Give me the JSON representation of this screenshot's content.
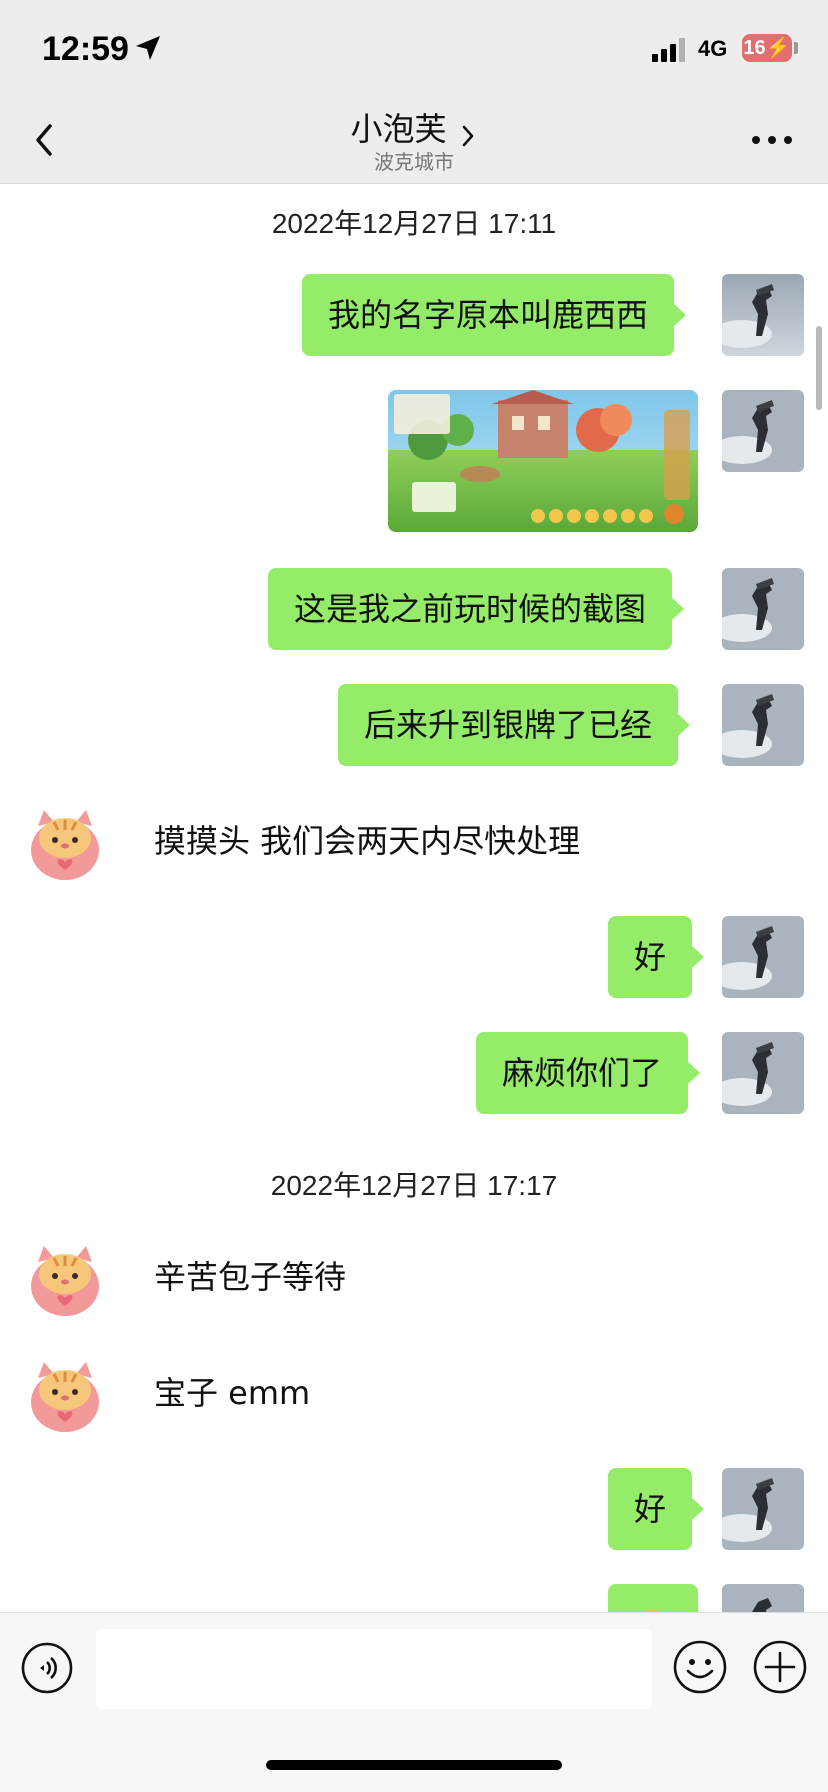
{
  "status_bar": {
    "time": "12:59",
    "network": "4G",
    "battery": "16"
  },
  "header": {
    "title": "小泡芙",
    "subtitle": "波克城市"
  },
  "messages": [
    {
      "type": "timestamp",
      "text": "2022年12月27日 17:11"
    },
    {
      "type": "sent",
      "text": "我的名字原本叫鹿西西"
    },
    {
      "type": "sent-image",
      "text": ""
    },
    {
      "type": "sent",
      "text": "这是我之前玩时候的截图"
    },
    {
      "type": "sent",
      "text": "后来升到银牌了已经"
    },
    {
      "type": "received",
      "text": "摸摸头 我们会两天内尽快处理"
    },
    {
      "type": "sent",
      "text": "好"
    },
    {
      "type": "sent",
      "text": "麻烦你们了"
    },
    {
      "type": "timestamp",
      "text": "2022年12月27日 17:17"
    },
    {
      "type": "received",
      "text": "辛苦包子等待"
    },
    {
      "type": "received",
      "text": "宝子 emm"
    },
    {
      "type": "sent",
      "text": "好"
    },
    {
      "type": "sent-emoji",
      "text": ""
    }
  ],
  "input": {
    "value": "",
    "placeholder": ""
  },
  "colors": {
    "sent_bubble": "#95ec69",
    "header_bg": "#ededed",
    "input_bar_bg": "#f7f7f7"
  },
  "icons": [
    "location-arrow-icon",
    "signal-icon",
    "battery-icon",
    "back-chevron-icon",
    "chevron-right-icon",
    "more-dots-icon",
    "voice-icon",
    "emoji-icon",
    "plus-icon"
  ]
}
